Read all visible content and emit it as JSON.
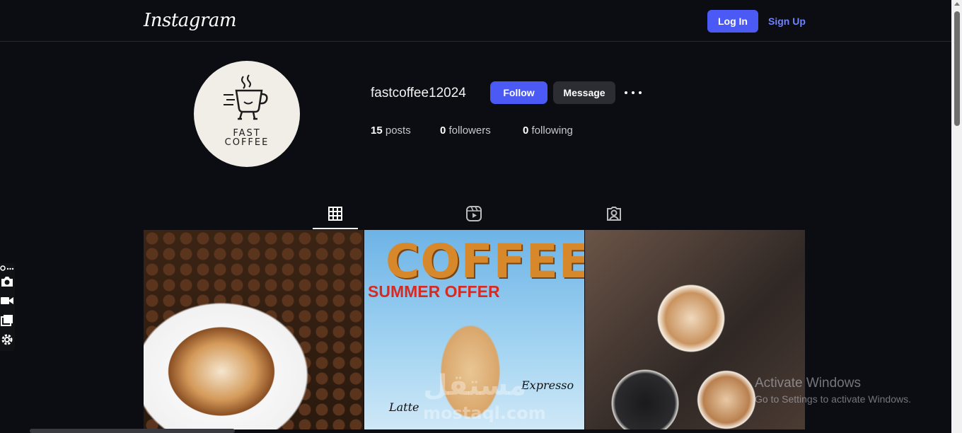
{
  "header": {
    "logo_text": "Instagram",
    "login_label": "Log In",
    "signup_label": "Sign Up"
  },
  "profile": {
    "avatar_line1": "FAST",
    "avatar_line2": "COFFEE",
    "username": "fastcoffee12024",
    "follow_label": "Follow",
    "message_label": "Message",
    "more_icon": "more-horizontal-icon",
    "stats": [
      {
        "count": "15",
        "label": "posts"
      },
      {
        "count": "0",
        "label": "followers"
      },
      {
        "count": "0",
        "label": "following"
      }
    ]
  },
  "tabs": [
    {
      "icon": "grid-icon",
      "active": true
    },
    {
      "icon": "reels-icon",
      "active": false
    },
    {
      "icon": "tagged-icon",
      "active": false
    }
  ],
  "posts": [
    {
      "desc_icon": "latte-art-photo"
    },
    {
      "title": "COFFEE",
      "subtitle": "SUMMER OFFER",
      "label_left": "Latte",
      "label_right": "Expresso"
    },
    {
      "desc_icon": "coffee-cups-photo"
    }
  ],
  "sidebar_tools": [
    "link-more-icon",
    "camera-icon",
    "video-icon",
    "window-icon",
    "settings-icon"
  ],
  "watermarks": {
    "windows_line1": "Activate Windows",
    "windows_line2": "Go to Settings to activate Windows.",
    "mostaql_ar": "مستقل",
    "mostaql_en": "mostaql.com"
  },
  "colors": {
    "accent": "#4c5af5",
    "background": "#0c0d13",
    "link": "#6f83ff"
  }
}
